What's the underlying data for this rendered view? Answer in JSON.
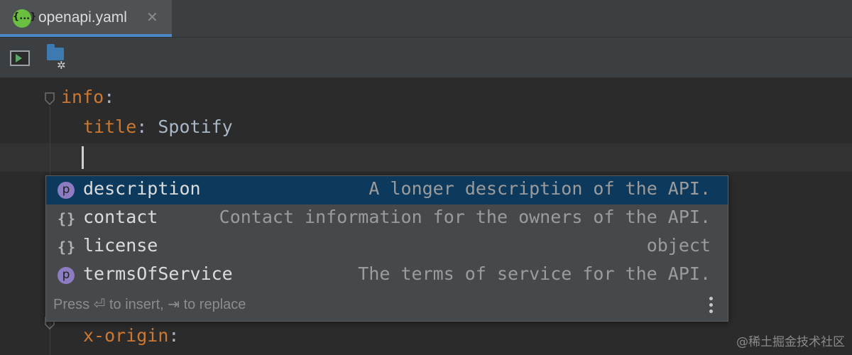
{
  "tab": {
    "title": "openapi.yaml",
    "icon_text": "{...}",
    "close_glyph": "✕"
  },
  "toolbar": {
    "run_icon": "run-panel-icon",
    "folder_icon": "folder-settings-icon"
  },
  "code": {
    "line1_key": "info",
    "line1_colon": ":",
    "line2_key": "title",
    "line2_sep": ": ",
    "line2_value": "Spotify",
    "line_last_key": "x-origin",
    "line_last_colon": ":"
  },
  "completion": {
    "items": [
      {
        "kind": "p",
        "name": "description",
        "desc": "A longer description of the API."
      },
      {
        "kind": "{}",
        "name": "contact",
        "desc": "Contact information for the owners of the API."
      },
      {
        "kind": "{}",
        "name": "license",
        "desc": "object"
      },
      {
        "kind": "p",
        "name": "termsOfService",
        "desc": "The terms of service for the API."
      }
    ],
    "hint": "Press ⏎ to insert, ⇥ to replace"
  },
  "watermark": "@稀土掘金技术社区",
  "colors": {
    "accent": "#4a88c7",
    "key": "#cc7832",
    "selection": "#0d3a5c",
    "property_icon": "#8e7cc3"
  }
}
